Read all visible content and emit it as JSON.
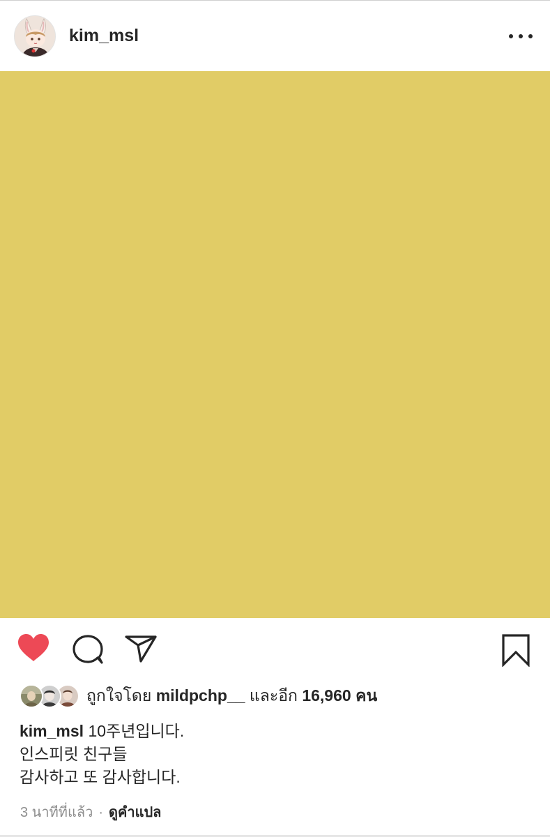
{
  "post": {
    "username": "kim_msl",
    "image_color": "#e1cc66"
  },
  "likes": {
    "prefix": "ถูกใจโดย ",
    "first_liker": "mildpchp__",
    "middle": " และอีก ",
    "count": "16,960",
    "suffix": " คน"
  },
  "caption": {
    "username": "kim_msl",
    "line1": " 10주년입니다.",
    "line2": "인스피릿 친구들",
    "line3": "감사하고 또 감사합니다."
  },
  "meta": {
    "time_ago": "3 นาทีที่แล้ว",
    "separator": "·",
    "translate": "ดูคำแปล"
  },
  "icons": {
    "more": "more-dots-icon",
    "like": "heart-filled-icon",
    "comment": "comment-bubble-icon",
    "share": "paper-plane-icon",
    "save": "bookmark-icon"
  },
  "colors": {
    "like_red": "#ed4956",
    "text": "#262626",
    "secondary_text": "#8e8e8e"
  }
}
